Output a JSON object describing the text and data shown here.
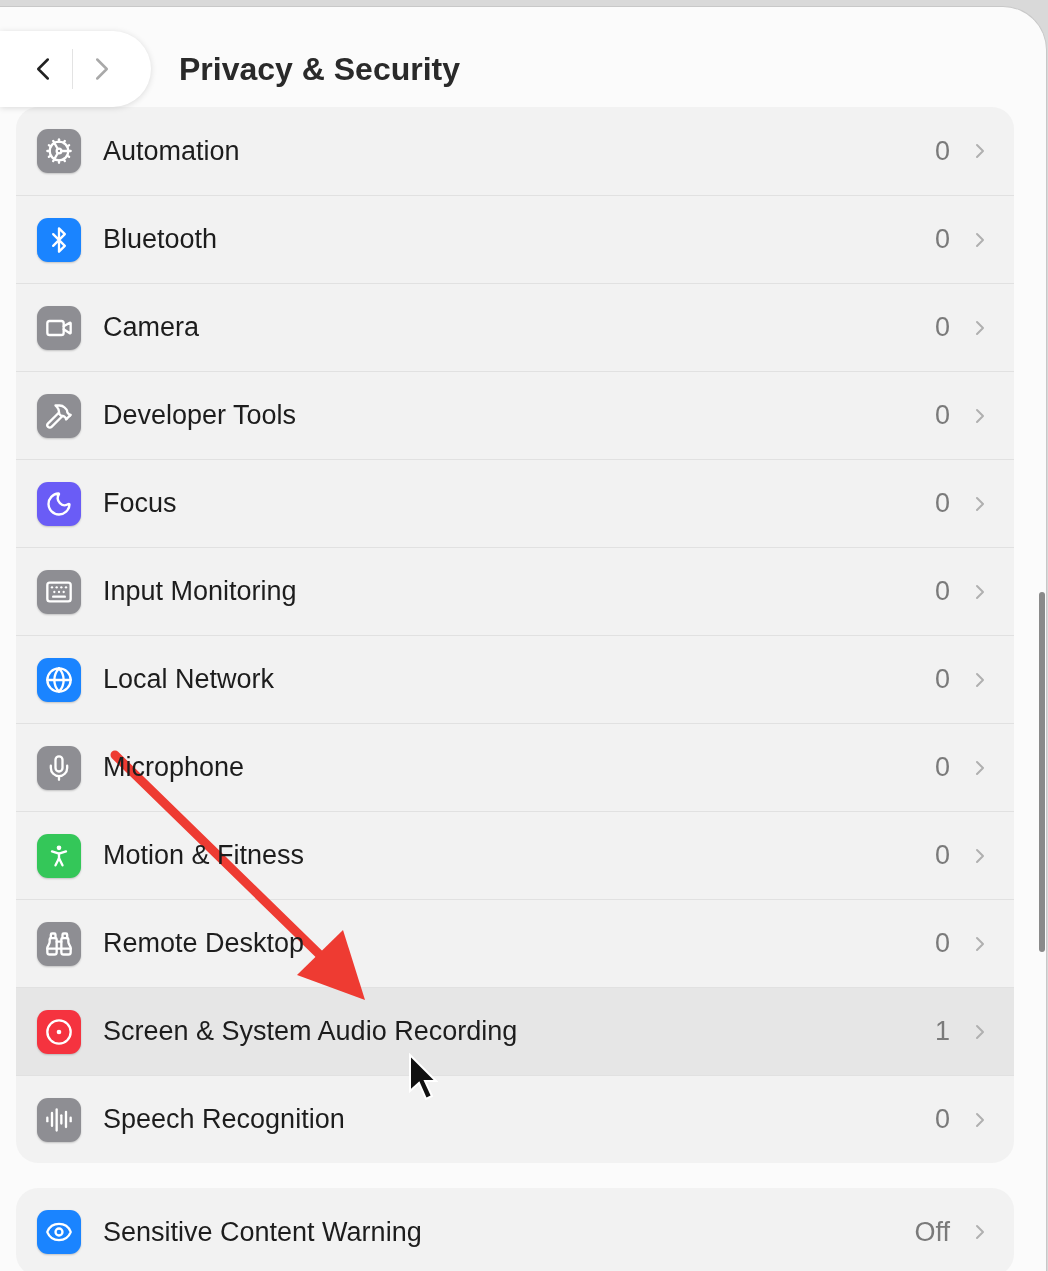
{
  "header": {
    "title": "Privacy & Security",
    "back": {
      "disabled": false
    },
    "forward": {
      "disabled": true
    }
  },
  "groups": [
    {
      "items": [
        {
          "label": "Automation",
          "count": "0",
          "color": "#8e8e93",
          "selected": false
        },
        {
          "label": "Bluetooth",
          "count": "0",
          "color": "#1a84ff",
          "selected": false
        },
        {
          "label": "Camera",
          "count": "0",
          "color": "#8e8e93",
          "selected": false
        },
        {
          "label": "Developer Tools",
          "count": "0",
          "color": "#8e8e93",
          "selected": false
        },
        {
          "label": "Focus",
          "count": "0",
          "color": "#6a5cf6",
          "selected": false
        },
        {
          "label": "Input Monitoring",
          "count": "0",
          "color": "#8e8e93",
          "selected": false
        },
        {
          "label": "Local Network",
          "count": "0",
          "color": "#1a84ff",
          "selected": false
        },
        {
          "label": "Microphone",
          "count": "0",
          "color": "#8e8e93",
          "selected": false
        },
        {
          "label": "Motion & Fitness",
          "count": "0",
          "color": "#34c759",
          "selected": false
        },
        {
          "label": "Remote Desktop",
          "count": "0",
          "color": "#8e8e93",
          "selected": false
        },
        {
          "label": "Screen & System Audio Recording",
          "count": "1",
          "color": "#f5333f",
          "selected": true
        },
        {
          "label": "Speech Recognition",
          "count": "0",
          "color": "#8e8e93",
          "selected": false
        }
      ]
    },
    {
      "items": [
        {
          "label": "Sensitive Content Warning",
          "count": "Off",
          "color": "#1a84ff",
          "selected": false
        }
      ]
    }
  ]
}
